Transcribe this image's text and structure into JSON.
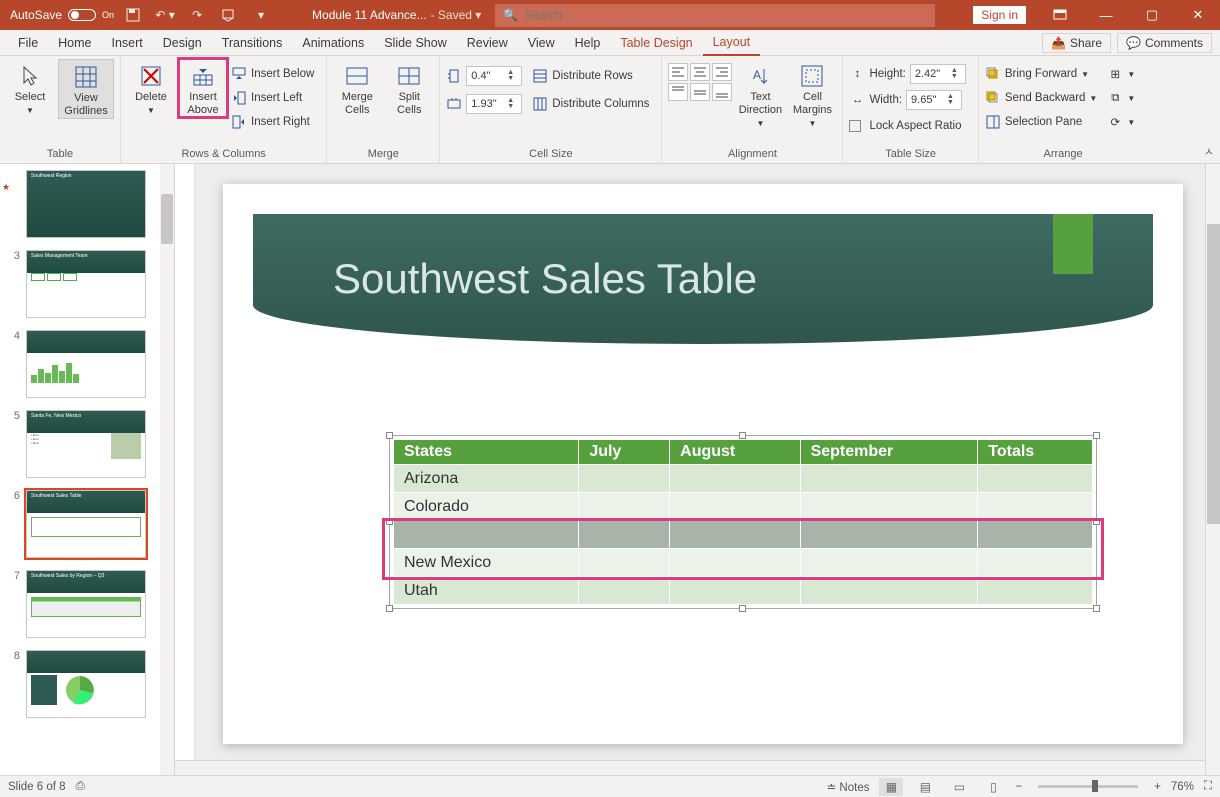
{
  "titlebar": {
    "autosave_label": "AutoSave",
    "autosave_state": "On",
    "doc_name": "Module 11 Advance...",
    "doc_state": "- Saved ▾",
    "search_placeholder": "Search",
    "signin": "Sign in"
  },
  "tabs": {
    "file": "File",
    "home": "Home",
    "insert": "Insert",
    "design": "Design",
    "transitions": "Transitions",
    "animations": "Animations",
    "slideshow": "Slide Show",
    "review": "Review",
    "view": "View",
    "help": "Help",
    "table_design": "Table Design",
    "layout": "Layout",
    "share": "Share",
    "comments": "Comments"
  },
  "ribbon": {
    "table": {
      "label": "Table",
      "select": "Select",
      "view_gridlines": "View Gridlines"
    },
    "rows_cols": {
      "label": "Rows & Columns",
      "delete": "Delete",
      "insert_above": "Insert Above",
      "insert_below": "Insert Below",
      "insert_left": "Insert Left",
      "insert_right": "Insert Right"
    },
    "merge": {
      "label": "Merge",
      "merge_cells": "Merge Cells",
      "split_cells": "Split Cells"
    },
    "cell_size": {
      "label": "Cell Size",
      "row_h": "0.4\"",
      "col_w": "1.93\"",
      "dist_rows": "Distribute Rows",
      "dist_cols": "Distribute Columns"
    },
    "alignment": {
      "label": "Alignment",
      "text_direction": "Text Direction",
      "cell_margins": "Cell Margins"
    },
    "table_size": {
      "label": "Table Size",
      "height_lbl": "Height:",
      "height_val": "2.42\"",
      "width_lbl": "Width:",
      "width_val": "9.65\"",
      "lock": "Lock Aspect Ratio"
    },
    "arrange": {
      "label": "Arrange",
      "bring_forward": "Bring Forward",
      "send_backward": "Send Backward",
      "selection_pane": "Selection Pane"
    }
  },
  "thumbnails": [
    {
      "num": "",
      "title": "Southwest Region",
      "kind": "cover"
    },
    {
      "num": "3",
      "title": "Sales Management Team",
      "kind": "org"
    },
    {
      "num": "4",
      "title": "",
      "kind": "charts",
      "star": true
    },
    {
      "num": "5",
      "title": "Santa Fe, New Mexico",
      "kind": "photo"
    },
    {
      "num": "6",
      "title": "Southwest Sales Table",
      "kind": "table",
      "selected": true
    },
    {
      "num": "7",
      "title": "Southwest Sales by Region – Q3",
      "kind": "table2"
    },
    {
      "num": "8",
      "title": "",
      "kind": "pie"
    }
  ],
  "slide": {
    "title": "Southwest Sales Table",
    "table": {
      "headers": [
        "States",
        "July",
        "August",
        "September",
        "Totals"
      ],
      "rows": [
        {
          "cells": [
            "Arizona",
            "",
            "",
            "",
            ""
          ],
          "band": 0
        },
        {
          "cells": [
            "Colorado",
            "",
            "",
            "",
            ""
          ],
          "band": 1
        },
        {
          "cells": [
            "",
            "",
            "",
            "",
            ""
          ],
          "band": 0,
          "selected": true,
          "highlighted": true
        },
        {
          "cells": [
            "New Mexico",
            "",
            "",
            "",
            ""
          ],
          "band": 1,
          "highlighted": true
        },
        {
          "cells": [
            "Utah",
            "",
            "",
            "",
            ""
          ],
          "band": 0
        }
      ]
    }
  },
  "status": {
    "slide_info": "Slide 6 of 8",
    "notes": "Notes",
    "zoom": "76%"
  }
}
